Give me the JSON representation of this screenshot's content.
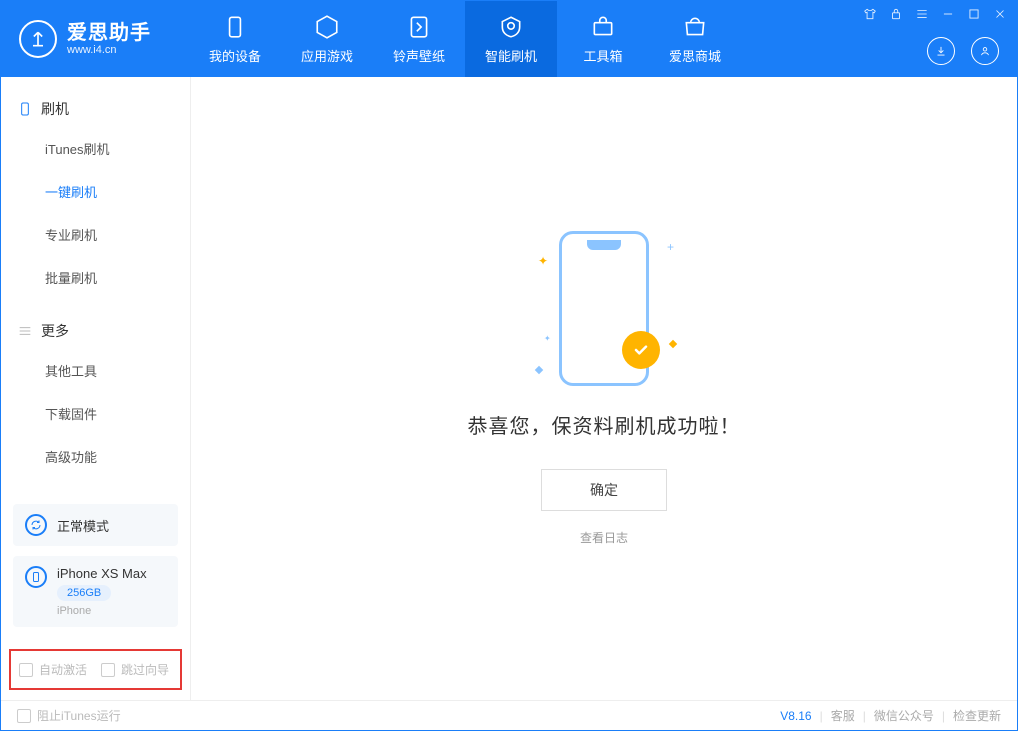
{
  "logo": {
    "title": "爱思助手",
    "subtitle": "www.i4.cn"
  },
  "nav": [
    {
      "label": "我的设备"
    },
    {
      "label": "应用游戏"
    },
    {
      "label": "铃声壁纸"
    },
    {
      "label": "智能刷机"
    },
    {
      "label": "工具箱"
    },
    {
      "label": "爱思商城"
    }
  ],
  "sidebar": {
    "group1_title": "刷机",
    "items1": [
      {
        "label": "iTunes刷机"
      },
      {
        "label": "一键刷机"
      },
      {
        "label": "专业刷机"
      },
      {
        "label": "批量刷机"
      }
    ],
    "group2_title": "更多",
    "items2": [
      {
        "label": "其他工具"
      },
      {
        "label": "下载固件"
      },
      {
        "label": "高级功能"
      }
    ]
  },
  "device_mode": {
    "label": "正常模式"
  },
  "device_info": {
    "name": "iPhone XS Max",
    "storage": "256GB",
    "type": "iPhone"
  },
  "options": {
    "auto_activate": "自动激活",
    "skip_guide": "跳过向导"
  },
  "main": {
    "success_text": "恭喜您，保资料刷机成功啦！",
    "confirm_label": "确定",
    "view_log_label": "查看日志"
  },
  "footer": {
    "block_itunes": "阻止iTunes运行",
    "version": "V8.16",
    "links": [
      "客服",
      "微信公众号",
      "检查更新"
    ]
  }
}
